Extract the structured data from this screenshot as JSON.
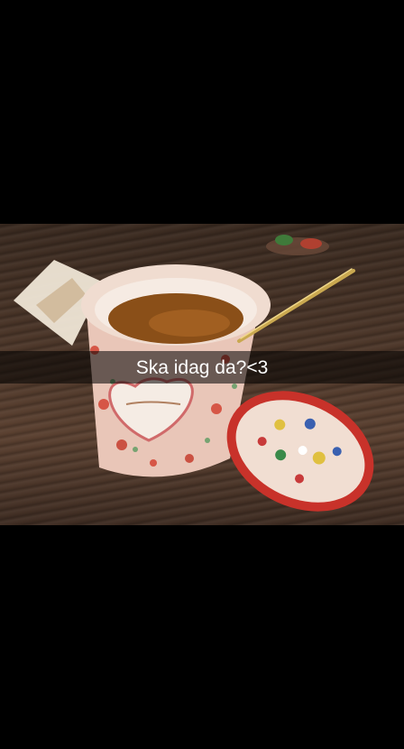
{
  "snap": {
    "caption": "Ska idag da?<3",
    "photo_description_icon": "tea-cup-photo"
  },
  "colors": {
    "background": "#000000",
    "caption_bar": "#000000",
    "caption_text": "#ffffff"
  }
}
